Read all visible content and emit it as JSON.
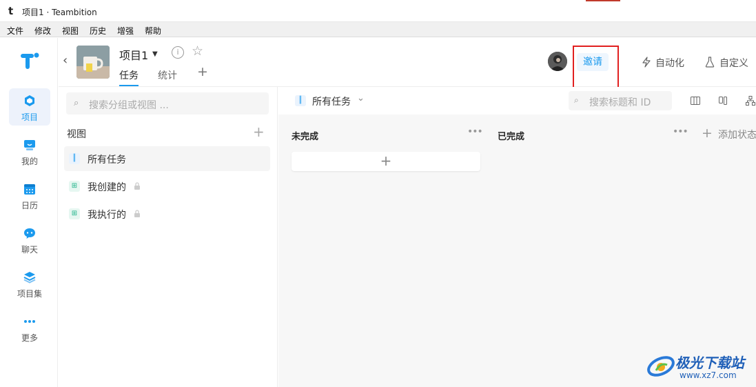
{
  "window": {
    "title": "项目1 · Teambition",
    "logo_glyph": "t"
  },
  "menu": [
    "文件",
    "修改",
    "视图",
    "历史",
    "增强",
    "帮助"
  ],
  "rail": {
    "items": [
      {
        "label": "项目",
        "icon": "project-icon",
        "active": true
      },
      {
        "label": "我的",
        "icon": "my-icon"
      },
      {
        "label": "日历",
        "icon": "calendar-icon"
      },
      {
        "label": "聊天",
        "icon": "chat-icon"
      },
      {
        "label": "项目集",
        "icon": "project-set-icon"
      },
      {
        "label": "更多",
        "icon": "more-icon"
      }
    ]
  },
  "header": {
    "project_name": "项目1",
    "tabs": [
      {
        "label": "任务",
        "active": true
      },
      {
        "label": "统计"
      }
    ],
    "invite_label": "邀请",
    "automation_label": "自动化",
    "customize_label": "自定义"
  },
  "views": {
    "search_placeholder": "搜索分组或视图 ...",
    "heading": "视图",
    "items": [
      {
        "label": "所有任务",
        "active": true,
        "locked": false
      },
      {
        "label": "我创建的",
        "locked": true
      },
      {
        "label": "我执行的",
        "locked": true
      }
    ]
  },
  "board": {
    "current_view": "所有任务",
    "search_placeholder": "搜索标题和 ID",
    "columns": [
      {
        "title": "未完成"
      },
      {
        "title": "已完成"
      }
    ],
    "add_status_label": "添加状态"
  },
  "watermark": {
    "title": "极光下载站",
    "url": "www.xz7.com"
  },
  "colors": {
    "accent": "#1b9aee",
    "highlight": "#e11f1f"
  }
}
